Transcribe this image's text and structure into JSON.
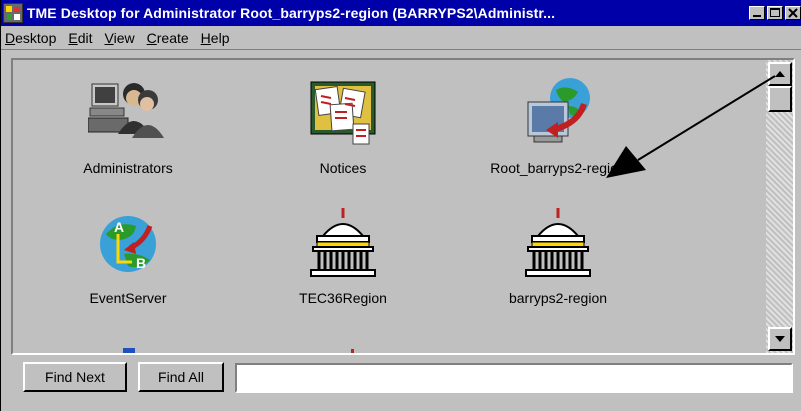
{
  "window": {
    "title": "TME Desktop for Administrator Root_barryps2-region (BARRYPS2\\Administr..."
  },
  "menu": [
    {
      "underline": "D",
      "rest": "esktop"
    },
    {
      "underline": "E",
      "rest": "dit"
    },
    {
      "underline": "V",
      "rest": "iew"
    },
    {
      "underline": "C",
      "rest": "reate"
    },
    {
      "underline": "H",
      "rest": "elp"
    }
  ],
  "tiles": [
    {
      "label": "Administrators",
      "icon": "administrators-icon"
    },
    {
      "label": "Notices",
      "icon": "notices-icon"
    },
    {
      "label": "Root_barryps2-region",
      "icon": "policy-region-icon"
    },
    {
      "label": "EventServer",
      "icon": "event-server-icon"
    },
    {
      "label": "TEC36Region",
      "icon": "region-building-icon"
    },
    {
      "label": "barryps2-region",
      "icon": "region-building-icon"
    }
  ],
  "bottom": {
    "find_next": "Find Next",
    "find_all": "Find All",
    "find_value": ""
  },
  "colors": {
    "titlebar": "#0000a8",
    "face": "#c0c0c0"
  }
}
